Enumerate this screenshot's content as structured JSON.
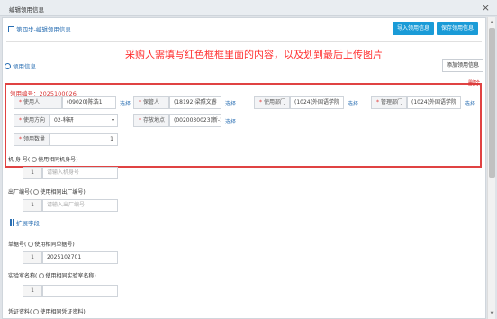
{
  "window": {
    "title": "编辑领用信息",
    "close": "×"
  },
  "header": {
    "step": "第四步-编辑领用信息",
    "import_button": "导入领用信息",
    "save_button": "保存领用信息"
  },
  "annotation": "采购人需填写红色框框里面的内容，以及划到最后上传图片",
  "section": {
    "title": "领用信息",
    "add_button": "添加领用信息"
  },
  "record": {
    "apply_no": "领用编号：2025100026",
    "delete": "删除",
    "pick": "选择",
    "fields": {
      "user": {
        "label": "使用人",
        "value": "(09020)陈浩1"
      },
      "keeper": {
        "label": "保管人",
        "value": "(18192)梁照文睿"
      },
      "use_dept": {
        "label": "使用部门",
        "value": "(1024)外国语学院"
      },
      "manage_dept": {
        "label": "管理部门",
        "value": "(1024)外国语学院"
      },
      "direction": {
        "label": "使用方向",
        "value": "02-科研"
      },
      "location": {
        "label": "存放地点",
        "value": "(0020030023)新-101"
      },
      "quantity": {
        "label": "领用数量",
        "value": "1"
      }
    }
  },
  "extra": {
    "machine_no": {
      "label": "机 身 号",
      "option": "使用相同机身号",
      "prefix": "1",
      "placeholder": "请输入机身号"
    },
    "factory_no": {
      "label": "出厂编号",
      "option": "使用相同出厂编号",
      "prefix": "1",
      "placeholder": "请输入出厂编号"
    },
    "expand_title": "扩展字段",
    "single_no": {
      "label": "单据号",
      "option": "使用相同单据号",
      "prefix": "1",
      "value": "2025102701"
    },
    "lab_name": {
      "label": "实验室名称",
      "option": "使用相同实验室名称",
      "prefix": "1",
      "value": ""
    },
    "voucher": {
      "label": "凭证资料",
      "option": "使用相同凭证资料"
    }
  }
}
